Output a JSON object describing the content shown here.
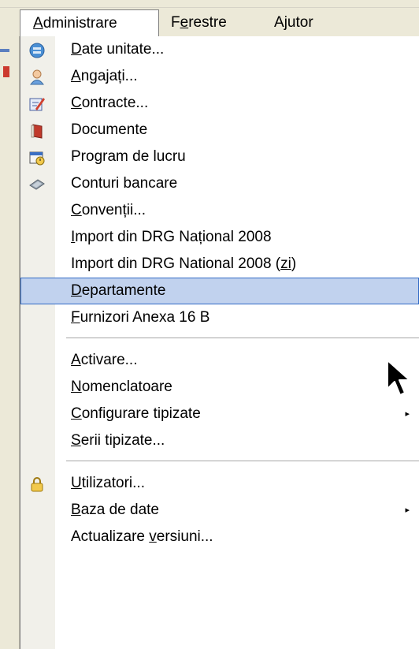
{
  "menubar": {
    "items": [
      {
        "pre": "",
        "u": "A",
        "post": "dministrare"
      },
      {
        "pre": "F",
        "u": "e",
        "post": "restre"
      },
      {
        "pre": "A",
        "u": "j",
        "post": "utor"
      }
    ]
  },
  "menu": {
    "items": [
      {
        "pre": "",
        "u": "D",
        "post": "ate unitate...",
        "icon": "database-icon"
      },
      {
        "pre": "",
        "u": "A",
        "post": "ngajați...",
        "icon": "user-icon"
      },
      {
        "pre": "",
        "u": "C",
        "post": "ontracte...",
        "icon": "contract-edit-icon"
      },
      {
        "pre": "Documente",
        "u": "",
        "post": "",
        "icon": "book-icon"
      },
      {
        "pre": "Program de lucru",
        "u": "",
        "post": "",
        "icon": "schedule-icon"
      },
      {
        "pre": "Conturi bancare",
        "u": "",
        "post": "",
        "icon": "card-icon"
      },
      {
        "pre": "",
        "u": "C",
        "post": "onvenții..."
      },
      {
        "pre": "",
        "u": "I",
        "post": "mport din DRG Național 2008"
      },
      {
        "pre": "Import din DRG National 2008 (",
        "u": "zi",
        "post": ")"
      },
      {
        "pre": "",
        "u": "D",
        "post": "epartamente"
      },
      {
        "pre": "",
        "u": "F",
        "post": "urnizori Anexa 16 B"
      },
      {
        "pre": "",
        "u": "A",
        "post": "ctivare..."
      },
      {
        "pre": "",
        "u": "N",
        "post": "omenclatoare"
      },
      {
        "pre": "",
        "u": "C",
        "post": "onfigurare tipizate",
        "submenu": true
      },
      {
        "pre": "",
        "u": "S",
        "post": "erii tipizate..."
      },
      {
        "pre": "",
        "u": "U",
        "post": "tilizatori...",
        "icon": "lock-icon"
      },
      {
        "pre": "",
        "u": "B",
        "post": "aza de date",
        "submenu": true
      },
      {
        "pre": "Actualizare ",
        "u": "v",
        "post": "ersiuni..."
      }
    ],
    "highlighted_index": 9,
    "submenu_arrow": "▸"
  }
}
